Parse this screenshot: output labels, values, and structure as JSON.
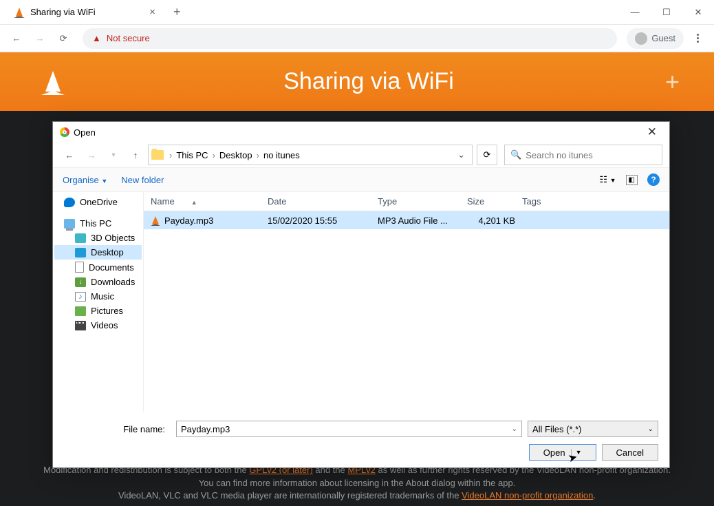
{
  "browser": {
    "tab_title": "Sharing via WiFi",
    "not_secure": "Not secure",
    "guest": "Guest"
  },
  "vlc": {
    "title": "Sharing via WiFi"
  },
  "dialog": {
    "title": "Open",
    "crumbs": [
      "This PC",
      "Desktop",
      "no itunes"
    ],
    "search_placeholder": "Search no itunes",
    "organise": "Organise",
    "new_folder": "New folder",
    "side": {
      "onedrive": "OneDrive",
      "thispc": "This PC",
      "objects3d": "3D Objects",
      "desktop": "Desktop",
      "documents": "Documents",
      "downloads": "Downloads",
      "music": "Music",
      "pictures": "Pictures",
      "videos": "Videos"
    },
    "columns": {
      "name": "Name",
      "date": "Date",
      "type": "Type",
      "size": "Size",
      "tags": "Tags"
    },
    "file": {
      "name": "Payday.mp3",
      "date": "15/02/2020 15:55",
      "type": "MP3 Audio File ...",
      "size": "4,201 KB"
    },
    "filename_label": "File name:",
    "filename_value": "Payday.mp3",
    "filter": "All Files (*.*)",
    "open": "Open",
    "cancel": "Cancel"
  },
  "footer": {
    "line1a": "Modification and redistribution is subject to both the ",
    "link1": "GPLv2 (or later)",
    "line1b": " and the ",
    "link2": "MPLv2",
    "line1c": " as well as further rights reserved by the VideoLAN non-profit organization.",
    "line2": "You can find more information about licensing in the About dialog within the app.",
    "line3a": "VideoLAN, VLC and VLC media player are internationally registered trademarks of the ",
    "link3": "VideoLAN non-profit organization",
    "line3b": "."
  }
}
